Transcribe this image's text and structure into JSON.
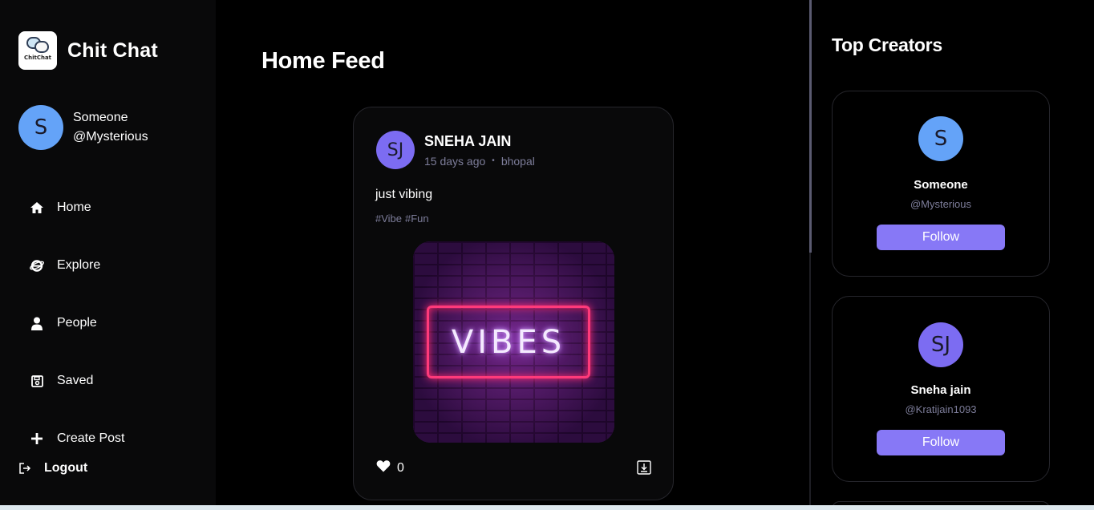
{
  "brand": {
    "name": "Chit Chat",
    "logo_text": "ChitChat"
  },
  "user": {
    "initial": "S",
    "name": "Someone",
    "handle": "@Mysterious"
  },
  "nav": [
    {
      "label": "Home",
      "icon": "home-icon"
    },
    {
      "label": "Explore",
      "icon": "explore-icon"
    },
    {
      "label": "People",
      "icon": "people-icon"
    },
    {
      "label": "Saved",
      "icon": "saved-icon"
    },
    {
      "label": "Create Post",
      "icon": "plus-icon"
    }
  ],
  "logout": {
    "label": "Logout",
    "icon": "logout-icon"
  },
  "main": {
    "title": "Home Feed"
  },
  "post": {
    "author_initials": "SJ",
    "author": "SNEHA JAIN",
    "time": "15 days ago",
    "location": "bhopal",
    "caption": "just vibing",
    "tags": [
      "#Vibe",
      "#Fun"
    ],
    "image_text": "VIBES",
    "likes": "0"
  },
  "right": {
    "title": "Top Creators",
    "creators": [
      {
        "initial": "S",
        "name": "Someone",
        "handle": "@Mysterious",
        "button": "Follow",
        "color": "#64a3f8"
      },
      {
        "initial": "SJ",
        "name": "Sneha jain",
        "handle": "@Kratijain1093",
        "button": "Follow",
        "color": "#7c6cf2"
      }
    ]
  },
  "colors": {
    "accent": "#8778f6",
    "muted": "#7d7d9a",
    "background": "#000000"
  }
}
